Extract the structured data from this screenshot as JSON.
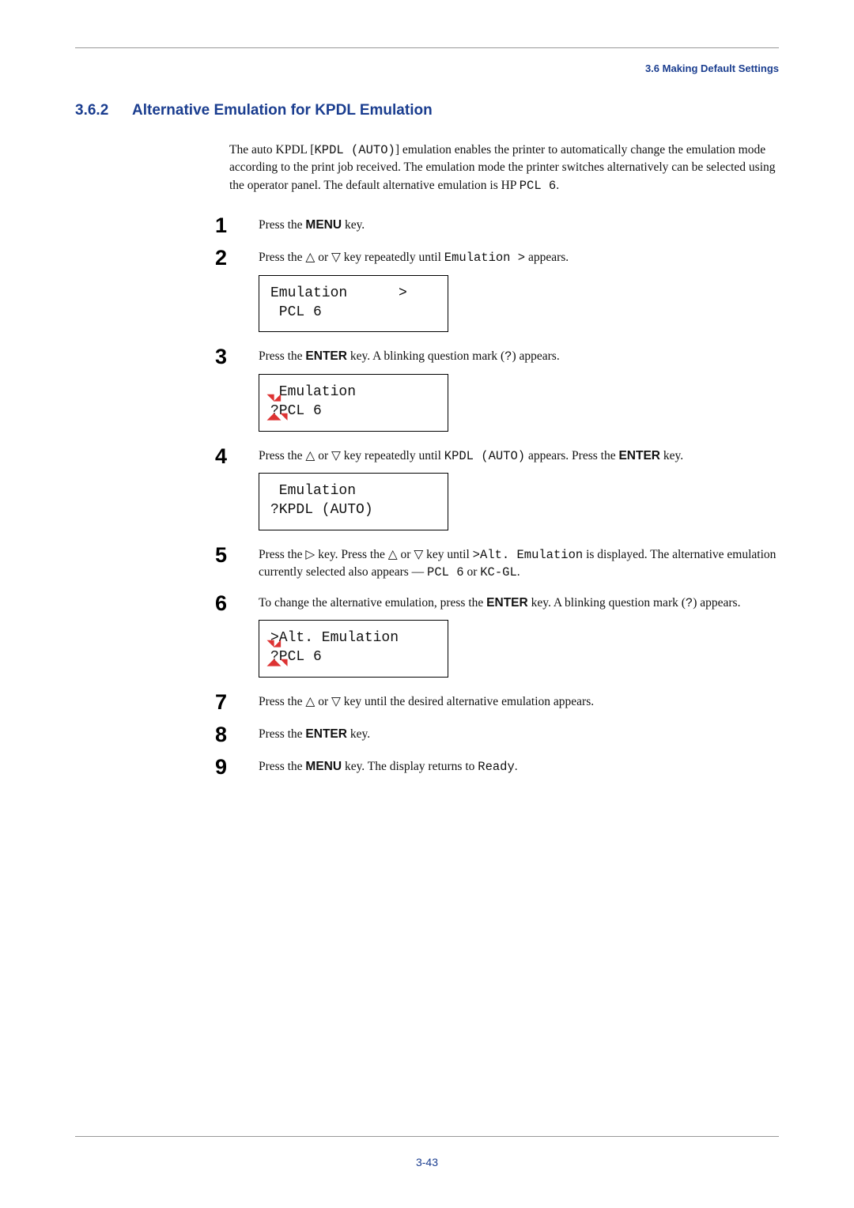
{
  "header": {
    "breadcrumb": "3.6 Making Default Settings"
  },
  "section": {
    "number": "3.6.2",
    "title": "Alternative Emulation for KPDL Emulation"
  },
  "intro": {
    "t1": "The auto KPDL [",
    "t2": "KPDL (AUTO)",
    "t3": "] emulation enables the printer to automatically change the emulation mode according to the print job received. The emulation mode the printer switches alternatively can be selected using the operator panel. The default alternative emulation is HP ",
    "t4": "PCL 6",
    "t5": "."
  },
  "steps": {
    "s1": {
      "t1": "Press the ",
      "menu": "MENU",
      "t2": " key."
    },
    "s2": {
      "t1": "Press the △ or ▽ key repeatedly until ",
      "mono1": "Emulation >",
      "t2": " appears.",
      "lcd_l1": "Emulation      >",
      "lcd_l2": " PCL 6"
    },
    "s3": {
      "t1": "Press the ",
      "enter": "ENTER",
      "t2": " key. A blinking question mark (",
      "q": "?",
      "t3": ") appears.",
      "lcd_l1": " Emulation",
      "lcd_l2": "?PCL 6"
    },
    "s4": {
      "t1": "Press the △ or ▽ key repeatedly until ",
      "mono1": "KPDL (AUTO)",
      "t2": " appears. Press the ",
      "enter": "ENTER",
      "t3": " key.",
      "lcd_l1": " Emulation",
      "lcd_l2": "?KPDL (AUTO)"
    },
    "s5": {
      "t1": "Press the ▷ key. Press the △ or ▽ key until ",
      "mono1": ">Alt. Emulation",
      "t2": " is displayed. The alternative emulation currently selected also appears — ",
      "mono2": "PCL 6",
      "t3": " or ",
      "mono3": "KC-GL",
      "t4": "."
    },
    "s6": {
      "t1": "To change the alternative emulation, press the ",
      "enter": "ENTER",
      "t2": " key. A blinking question mark (",
      "q": "?",
      "t3": ") appears.",
      "lcd_l1": ">Alt. Emulation",
      "lcd_l2": "?PCL 6"
    },
    "s7": {
      "t1": "Press the △ or ▽ key until the desired alternative emulation appears."
    },
    "s8": {
      "t1": "Press the ",
      "enter": "ENTER",
      "t2": " key."
    },
    "s9": {
      "t1": "Press the ",
      "menu": "MENU",
      "t2": " key. The display returns to ",
      "mono1": "Ready",
      "t3": "."
    }
  },
  "footer": {
    "pagenum": "3-43"
  }
}
